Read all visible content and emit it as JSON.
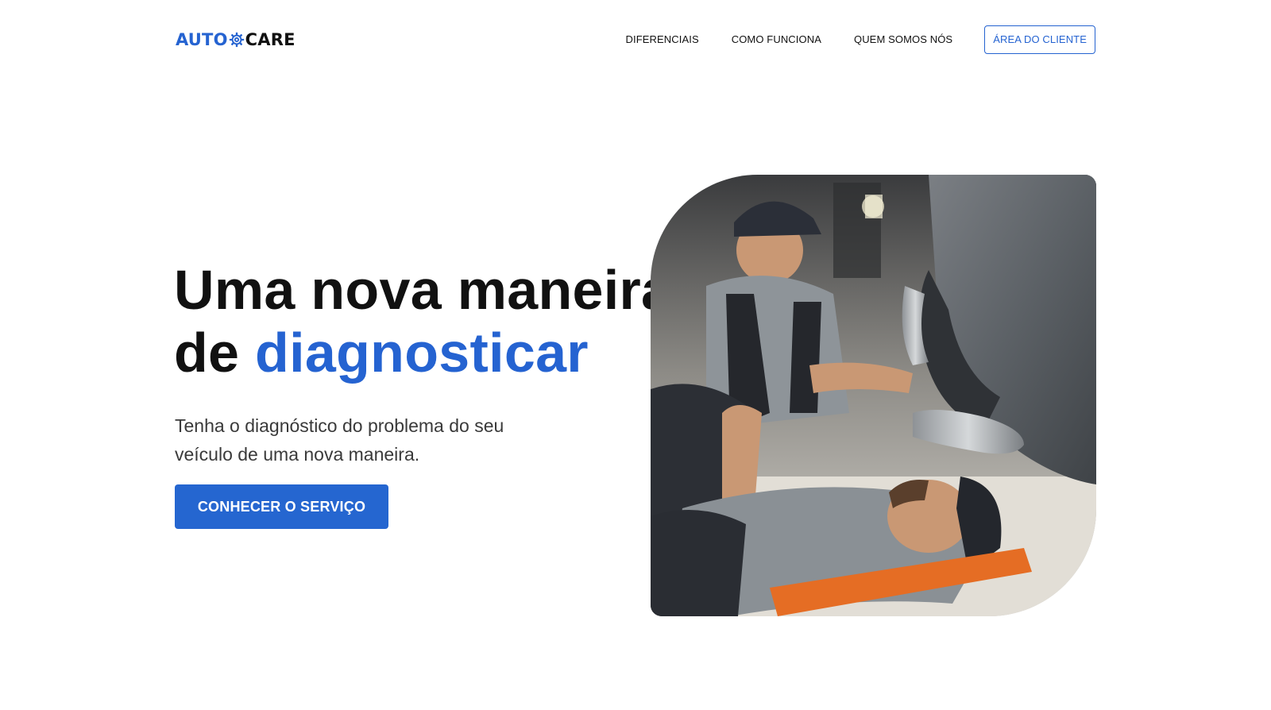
{
  "brand": {
    "auto": "AUTO",
    "care": "CARE",
    "gear_icon": "gear-icon",
    "accent_color": "#2563d1"
  },
  "nav": {
    "items": [
      {
        "label": "DIFERENCIAIS"
      },
      {
        "label": "COMO FUNCIONA"
      },
      {
        "label": "QUEM SOMOS NÓS"
      }
    ],
    "client_button": "ÁREA DO CLIENTE"
  },
  "hero": {
    "title_line1": "Uma nova maneira",
    "title_line2_prefix": "de ",
    "title_line2_accent": "diagnosticar",
    "subtitle": "Tenha o diagnóstico do problema do seu veículo de uma nova maneira.",
    "cta_label": "CONHECER O SERVIÇO",
    "cta_color": "#2566d0"
  }
}
